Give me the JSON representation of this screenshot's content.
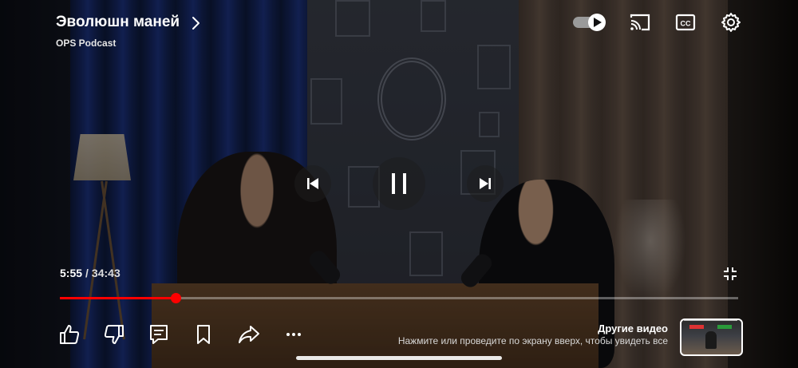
{
  "video": {
    "title": "Эволюшн маней",
    "channel": "OPS Podcast"
  },
  "playback": {
    "current_time": "5:55",
    "separator": "/",
    "duration": "34:43",
    "progress_fraction": 0.171,
    "state": "playing",
    "autoplay_on": true
  },
  "more_videos": {
    "title": "Другие видео",
    "hint": "Нажмите или проведите по экрану вверх, чтобы увидеть все"
  },
  "colors": {
    "progress": "#ff0000",
    "text": "#ffffff"
  },
  "icons": {
    "title_chevron": "chevron-right-icon",
    "autoplay": "autoplay-toggle",
    "cast": "cast-icon",
    "captions": "closed-captions-icon",
    "settings": "gear-icon",
    "previous": "skip-previous-icon",
    "play_pause": "pause-icon",
    "next": "skip-next-icon",
    "exit_fullscreen": "exit-fullscreen-icon",
    "like": "thumbs-up-icon",
    "dislike": "thumbs-down-icon",
    "comments": "comments-icon",
    "save": "bookmark-icon",
    "share": "share-icon",
    "more": "more-horizontal-icon"
  }
}
